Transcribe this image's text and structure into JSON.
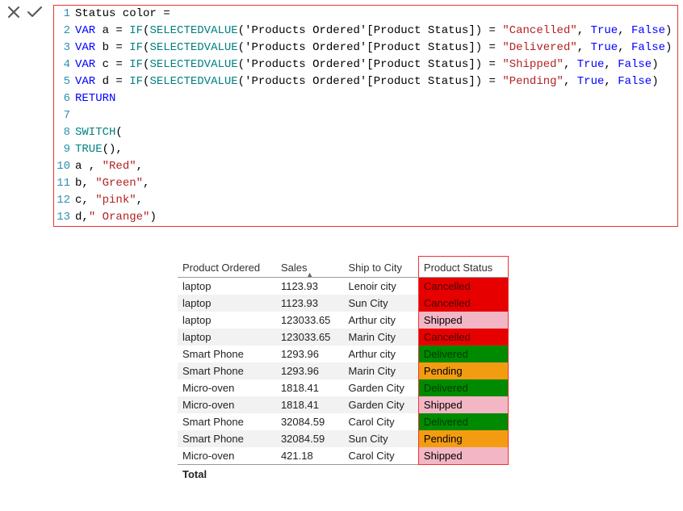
{
  "toolbar": {
    "cancel": "close-icon",
    "confirm": "check-icon"
  },
  "code": {
    "lines": [
      [
        {
          "t": "Status color ",
          "c": "k-id"
        },
        {
          "t": "=",
          "c": "k-id"
        }
      ],
      [
        {
          "t": "VAR ",
          "c": "k-var"
        },
        {
          "t": "a ",
          "c": "k-id"
        },
        {
          "t": "= ",
          "c": "k-id"
        },
        {
          "t": "IF",
          "c": "k-fn"
        },
        {
          "t": "(",
          "c": "k-paren"
        },
        {
          "t": "SELECTEDVALUE",
          "c": "k-fn"
        },
        {
          "t": "('Products Ordered'[Product Status]) = ",
          "c": "k-id"
        },
        {
          "t": "\"Cancelled\"",
          "c": "k-str"
        },
        {
          "t": ", ",
          "c": "k-id"
        },
        {
          "t": "True",
          "c": "k-bool"
        },
        {
          "t": ", ",
          "c": "k-id"
        },
        {
          "t": "False",
          "c": "k-bool"
        },
        {
          "t": ")",
          "c": "k-paren"
        }
      ],
      [
        {
          "t": "VAR ",
          "c": "k-var"
        },
        {
          "t": "b ",
          "c": "k-id"
        },
        {
          "t": "= ",
          "c": "k-id"
        },
        {
          "t": "IF",
          "c": "k-fn"
        },
        {
          "t": "(",
          "c": "k-paren"
        },
        {
          "t": "SELECTEDVALUE",
          "c": "k-fn"
        },
        {
          "t": "('Products Ordered'[Product Status]) = ",
          "c": "k-id"
        },
        {
          "t": "\"Delivered\"",
          "c": "k-str"
        },
        {
          "t": ", ",
          "c": "k-id"
        },
        {
          "t": "True",
          "c": "k-bool"
        },
        {
          "t": ", ",
          "c": "k-id"
        },
        {
          "t": "False",
          "c": "k-bool"
        },
        {
          "t": ")",
          "c": "k-paren"
        }
      ],
      [
        {
          "t": "VAR ",
          "c": "k-var"
        },
        {
          "t": "c ",
          "c": "k-id"
        },
        {
          "t": "= ",
          "c": "k-id"
        },
        {
          "t": "IF",
          "c": "k-fn"
        },
        {
          "t": "(",
          "c": "k-paren"
        },
        {
          "t": "SELECTEDVALUE",
          "c": "k-fn"
        },
        {
          "t": "('Products Ordered'[Product Status]) = ",
          "c": "k-id"
        },
        {
          "t": "\"Shipped\"",
          "c": "k-str"
        },
        {
          "t": ", ",
          "c": "k-id"
        },
        {
          "t": "True",
          "c": "k-bool"
        },
        {
          "t": ", ",
          "c": "k-id"
        },
        {
          "t": "False",
          "c": "k-bool"
        },
        {
          "t": ")",
          "c": "k-paren"
        }
      ],
      [
        {
          "t": "VAR ",
          "c": "k-var"
        },
        {
          "t": "d ",
          "c": "k-id"
        },
        {
          "t": "= ",
          "c": "k-id"
        },
        {
          "t": "IF",
          "c": "k-fn"
        },
        {
          "t": "(",
          "c": "k-paren"
        },
        {
          "t": "SELECTEDVALUE",
          "c": "k-fn"
        },
        {
          "t": "('Products Ordered'[Product Status]) = ",
          "c": "k-id"
        },
        {
          "t": "\"Pending\"",
          "c": "k-str"
        },
        {
          "t": ", ",
          "c": "k-id"
        },
        {
          "t": "True",
          "c": "k-bool"
        },
        {
          "t": ", ",
          "c": "k-id"
        },
        {
          "t": "False",
          "c": "k-bool"
        },
        {
          "t": ")",
          "c": "k-paren"
        }
      ],
      [
        {
          "t": "RETURN",
          "c": "k-var"
        }
      ],
      [
        {
          "t": "",
          "c": "k-id"
        }
      ],
      [
        {
          "t": "SWITCH",
          "c": "k-fn"
        },
        {
          "t": "(",
          "c": "k-paren"
        }
      ],
      [
        {
          "t": "TRUE",
          "c": "k-fn"
        },
        {
          "t": "(),",
          "c": "k-id"
        }
      ],
      [
        {
          "t": "a , ",
          "c": "k-id"
        },
        {
          "t": "\"Red\"",
          "c": "k-str"
        },
        {
          "t": ",",
          "c": "k-id"
        }
      ],
      [
        {
          "t": "b, ",
          "c": "k-id"
        },
        {
          "t": "\"Green\"",
          "c": "k-str"
        },
        {
          "t": ",",
          "c": "k-id"
        }
      ],
      [
        {
          "t": "c, ",
          "c": "k-id"
        },
        {
          "t": "\"pink\"",
          "c": "k-str"
        },
        {
          "t": ",",
          "c": "k-id"
        }
      ],
      [
        {
          "t": "d,",
          "c": "k-id"
        },
        {
          "t": "\" Orange\"",
          "c": "k-str"
        },
        {
          "t": ")",
          "c": "k-paren"
        }
      ]
    ]
  },
  "table": {
    "headers": {
      "product": "Product Ordered",
      "sales": "Sales",
      "city": "Ship to City",
      "status": "Product Status"
    },
    "status_colors": {
      "Cancelled": "#e60000",
      "Delivered": "#008a00",
      "Shipped": "#f3b6c5",
      "Pending": "#f39c12"
    },
    "rows": [
      {
        "product": "laptop",
        "sales": "1123.93",
        "city": "Lenoir city",
        "status": "Cancelled"
      },
      {
        "product": "laptop",
        "sales": "1123.93",
        "city": "Sun City",
        "status": "Cancelled"
      },
      {
        "product": "laptop",
        "sales": "123033.65",
        "city": "Arthur city",
        "status": "Shipped"
      },
      {
        "product": "laptop",
        "sales": "123033.65",
        "city": "Marin City",
        "status": "Cancelled"
      },
      {
        "product": "Smart Phone",
        "sales": "1293.96",
        "city": "Arthur city",
        "status": "Delivered"
      },
      {
        "product": "Smart Phone",
        "sales": "1293.96",
        "city": "Marin City",
        "status": "Pending"
      },
      {
        "product": "Micro-oven",
        "sales": "1818.41",
        "city": "Garden City",
        "status": "Delivered"
      },
      {
        "product": "Micro-oven",
        "sales": "1818.41",
        "city": "Garden City",
        "status": "Shipped"
      },
      {
        "product": "Smart Phone",
        "sales": "32084.59",
        "city": "Carol City",
        "status": "Delivered"
      },
      {
        "product": "Smart Phone",
        "sales": "32084.59",
        "city": "Sun City",
        "status": "Pending"
      },
      {
        "product": "Micro-oven",
        "sales": "421.18",
        "city": "Carol City",
        "status": "Shipped"
      }
    ],
    "footer": {
      "label": "Total"
    }
  }
}
